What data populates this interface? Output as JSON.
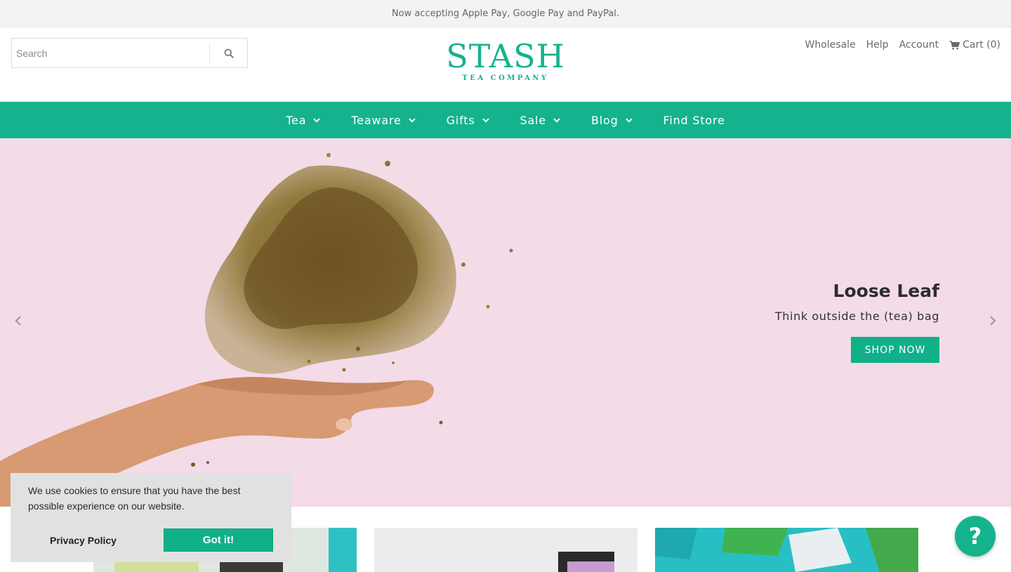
{
  "announcement": "Now accepting Apple Pay, Google Pay and PayPal.",
  "search": {
    "placeholder": "Search"
  },
  "logo": {
    "main": "STASH",
    "sub": "TEA COMPANY"
  },
  "utility_links": {
    "wholesale": "Wholesale",
    "help": "Help",
    "account": "Account",
    "cart": "Cart (0)"
  },
  "nav": {
    "items": [
      {
        "label": "Tea",
        "has_dropdown": true
      },
      {
        "label": "Teaware",
        "has_dropdown": true
      },
      {
        "label": "Gifts",
        "has_dropdown": true
      },
      {
        "label": "Sale",
        "has_dropdown": true
      },
      {
        "label": "Blog",
        "has_dropdown": true
      },
      {
        "label": "Find Store",
        "has_dropdown": false
      }
    ]
  },
  "hero": {
    "title": "Loose Leaf",
    "subtitle": "Think outside the (tea) bag",
    "button": "SHOP NOW"
  },
  "cookie": {
    "text": "We use cookies to ensure that you have the best possible experience on our website.",
    "policy_link": "Privacy Policy",
    "accept_button": "Got it!"
  },
  "help_button": "?",
  "colors": {
    "brand_green": "#14b38d",
    "hero_pink": "#f4dbe8",
    "announcement_bg": "#f3f3f3",
    "cookie_bg": "#e1e1e1"
  },
  "icons": {
    "search": "search-icon",
    "cart": "cart-icon",
    "chevron": "chevron-down-icon",
    "prev": "chevron-left-icon",
    "next": "chevron-right-icon"
  }
}
